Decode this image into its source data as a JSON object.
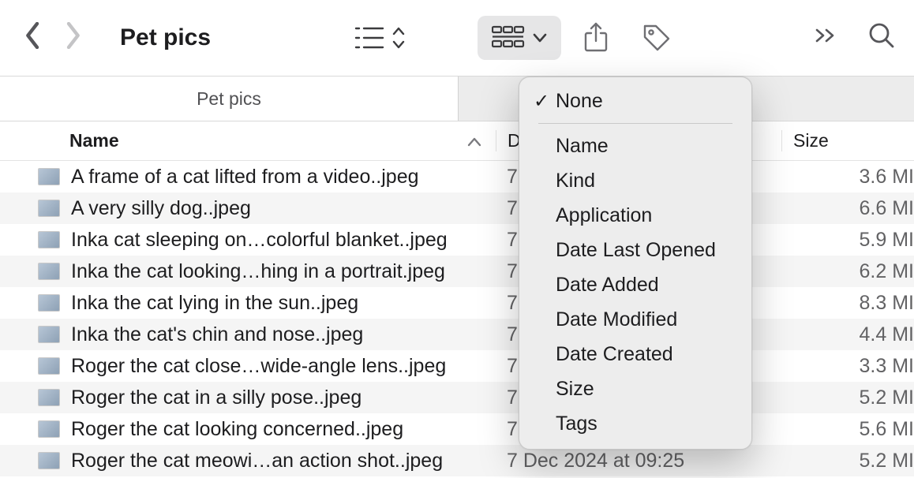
{
  "window": {
    "title": "Pet pics"
  },
  "tabs": {
    "active": "Pet pics",
    "inactive_placeholder": ""
  },
  "columns": {
    "name": "Name",
    "date": "D",
    "size": "Size"
  },
  "files": [
    {
      "name": "A frame of a cat lifted from a video..jpeg",
      "date": "7",
      "size": "3.6 MI"
    },
    {
      "name": "A very silly dog..jpeg",
      "date": "7",
      "size": "6.6 MI"
    },
    {
      "name": "Inka cat sleeping on…colorful blanket..jpeg",
      "date": "7",
      "size": "5.9 MI"
    },
    {
      "name": "Inka the cat looking…hing in a portrait.jpeg",
      "date": "7",
      "size": "6.2 MI"
    },
    {
      "name": "Inka the cat lying in the sun..jpeg",
      "date": "7",
      "size": "8.3 MI"
    },
    {
      "name": "Inka the cat's chin and nose..jpeg",
      "date": "7",
      "size": "4.4 MI"
    },
    {
      "name": "Roger the cat close…wide-angle lens..jpeg",
      "date": "7",
      "size": "3.3 MI"
    },
    {
      "name": "Roger the cat in a silly pose..jpeg",
      "date": "7",
      "size": "5.2 MI"
    },
    {
      "name": "Roger the cat looking concerned..jpeg",
      "date": "7",
      "size": "5.6 MI"
    },
    {
      "name": "Roger the cat meowi…an action shot..jpeg",
      "date": "7 Dec 2024 at 09:25",
      "size": "5.2 MI"
    }
  ],
  "group_menu": {
    "selected": "None",
    "items": [
      "None",
      "Name",
      "Kind",
      "Application",
      "Date Last Opened",
      "Date Added",
      "Date Modified",
      "Date Created",
      "Size",
      "Tags"
    ]
  }
}
